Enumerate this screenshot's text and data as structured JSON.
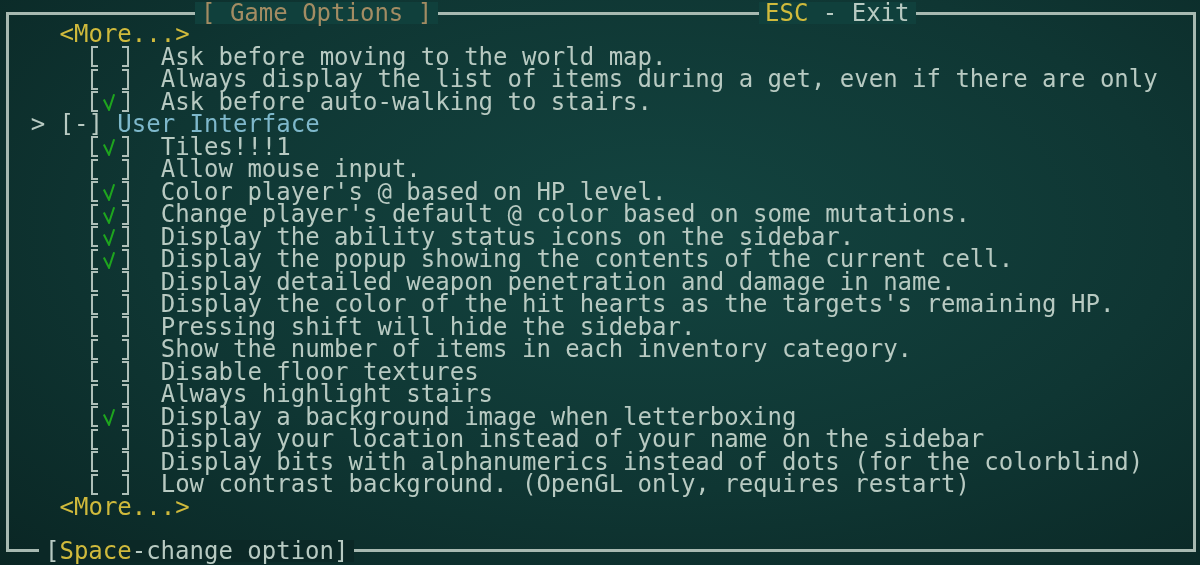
{
  "title": "[ Game Options ]",
  "exit_hint": {
    "key": "ESC",
    "label": "- Exit"
  },
  "more_top": "<More...>",
  "options": [
    {
      "label": "Ask before moving to the world map.",
      "checked": false
    },
    {
      "label": "Always display the list of items during a get, even if there are only",
      "checked": false
    },
    {
      "label": "Ask before auto-walking to stairs.",
      "checked": true
    }
  ],
  "section": {
    "cursor": ">",
    "toggle": "[-]",
    "label": "User Interface",
    "options": [
      {
        "label": "Tiles!!!1",
        "checked": true
      },
      {
        "label": "Allow mouse input.",
        "checked": false
      },
      {
        "label": "Color player's @ based on HP level.",
        "checked": true
      },
      {
        "label": "Change player's default @ color based on some mutations.",
        "checked": true
      },
      {
        "label": "Display the ability status icons on the sidebar.",
        "checked": true
      },
      {
        "label": "Display the popup showing the contents of the current cell.",
        "checked": true
      },
      {
        "label": "Display detailed weapon penetration and damage in name.",
        "checked": false
      },
      {
        "label": "Display the color of the hit hearts as the targets's remaining HP.",
        "checked": false
      },
      {
        "label": "Pressing shift will hide the sidebar.",
        "checked": false
      },
      {
        "label": "Show the number of items in each inventory category.",
        "checked": false
      },
      {
        "label": "Disable floor textures",
        "checked": false
      },
      {
        "label": "Always highlight stairs",
        "checked": false
      },
      {
        "label": "Display a background image when letterboxing",
        "checked": true
      },
      {
        "label": "Display your location instead of your name on the sidebar",
        "checked": false
      },
      {
        "label": "Display bits with alphanumerics instead of dots (for the colorblind)",
        "checked": false
      },
      {
        "label": "Low contrast background. (OpenGL only, requires restart)",
        "checked": false
      }
    ]
  },
  "more_bottom": "<More...>",
  "footer": {
    "open": "[",
    "key": "Space",
    "label": "-change option]"
  }
}
